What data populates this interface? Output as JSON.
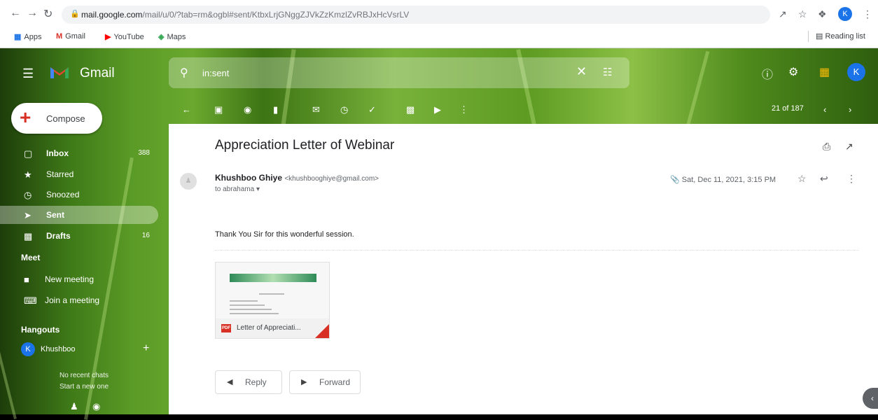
{
  "browser": {
    "url_host": "mail.google.com",
    "url_path": "/mail/u/0/?tab=rm&ogbl#sent/KtbxLrjGNggZJVkZzKmzlZvRBJxHcVsrLV",
    "profile_initial": "K",
    "bookmarks": [
      {
        "label": "Apps",
        "icon": "apps-grid-icon"
      },
      {
        "label": "Gmail",
        "icon": "gmail-icon"
      },
      {
        "label": "YouTube",
        "icon": "youtube-icon"
      },
      {
        "label": "Maps",
        "icon": "maps-icon"
      }
    ],
    "reading_list": "Reading list"
  },
  "gmail": {
    "product_name": "Gmail",
    "search_query": "in:sent",
    "compose_label": "Compose",
    "account_initial": "K",
    "nav": [
      {
        "label": "Inbox",
        "count": "388",
        "icon": "inbox-icon"
      },
      {
        "label": "Starred",
        "count": "",
        "icon": "star-icon"
      },
      {
        "label": "Snoozed",
        "count": "",
        "icon": "clock-icon"
      },
      {
        "label": "Sent",
        "count": "",
        "icon": "send-icon",
        "active": true
      },
      {
        "label": "Drafts",
        "count": "16",
        "icon": "draft-icon"
      }
    ],
    "meet": {
      "heading": "Meet",
      "new_meeting": "New meeting",
      "join_meeting": "Join a meeting"
    },
    "hangouts": {
      "heading": "Hangouts",
      "user_name": "Khushboo",
      "user_initial": "K",
      "no_recent": "No recent chats",
      "start_new": "Start a new one"
    },
    "pager": "21 of 187"
  },
  "email": {
    "subject": "Appreciation Letter of Webinar",
    "sender_name": "Khushboo Ghiye",
    "sender_email": "<khushbooghiye@gmail.com>",
    "to_line": "to abrahama",
    "date": "Sat, Dec 11, 2021, 3:15 PM",
    "body": "Thank You Sir for this wonderful session.",
    "attachment_name": "Letter of Appreciati...",
    "attachment_type": "PDF",
    "reply_label": "Reply",
    "forward_label": "Forward"
  },
  "colors": {
    "accent": "#1a73e8",
    "compose_plus": "#d93025",
    "pdf_red": "#d93025"
  }
}
